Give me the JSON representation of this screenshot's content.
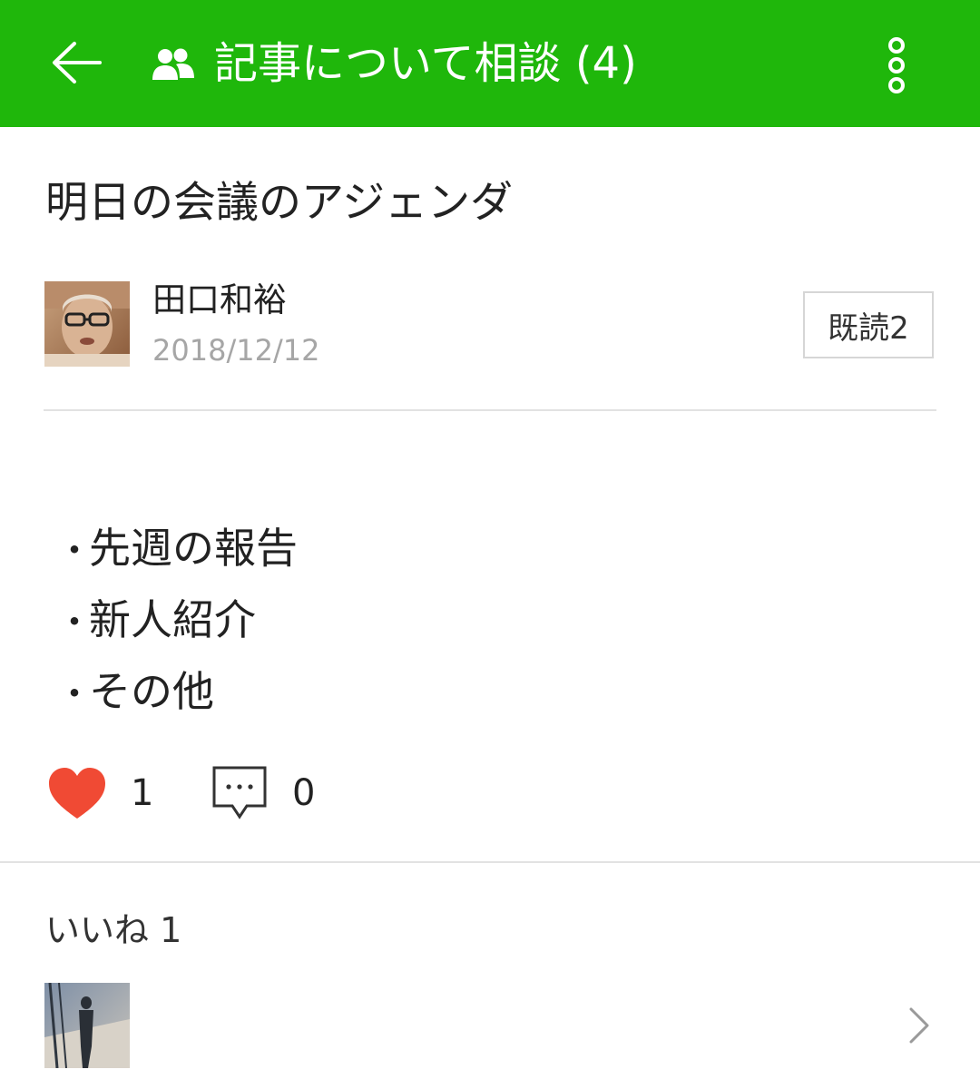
{
  "header": {
    "title": "記事について相談 (4)",
    "bg_color": "#1fb70b",
    "icons": [
      "back-arrow-icon",
      "group-icon",
      "more-vertical-icon"
    ]
  },
  "post": {
    "title": "明日の会議のアジェンダ",
    "author": "田口和裕",
    "date": "2018/12/12",
    "read_badge": "既読2",
    "body_items": [
      {
        "bullet": "・",
        "text": "先週の報告"
      },
      {
        "bullet": "・",
        "text": "新人紹介"
      },
      {
        "bullet": "・",
        "text": "その他"
      }
    ]
  },
  "actions": {
    "like_count": "1",
    "comment_count": "0",
    "like_color": "#f04a34"
  },
  "likes_section": {
    "label": "いいね 1"
  }
}
